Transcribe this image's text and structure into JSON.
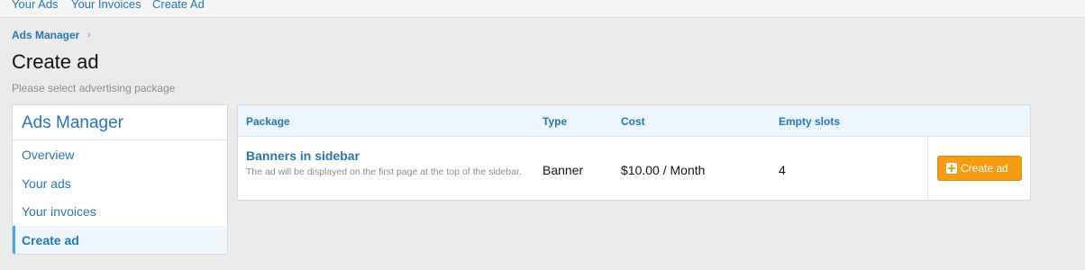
{
  "topnav": {
    "items": [
      {
        "label": "Your Ads"
      },
      {
        "label": "Your Invoices"
      },
      {
        "label": "Create Ad"
      }
    ]
  },
  "breadcrumb": {
    "label": "Ads Manager",
    "separator": "›"
  },
  "page": {
    "title": "Create ad",
    "description": "Please select advertising package"
  },
  "sidebar": {
    "title": "Ads Manager",
    "items": [
      {
        "label": "Overview"
      },
      {
        "label": "Your ads"
      },
      {
        "label": "Your invoices"
      },
      {
        "label": "Create ad",
        "active": true
      }
    ]
  },
  "table": {
    "headers": {
      "package": "Package",
      "type": "Type",
      "cost": "Cost",
      "empty_slots": "Empty slots"
    },
    "rows": [
      {
        "title": "Banners in sidebar",
        "description": "The ad will be displayed on the first page at the top of the sidebar.",
        "type": "Banner",
        "cost": "$10.00 / Month",
        "empty_slots": "4",
        "action_label": "Create ad",
        "action_icon": "plus-square-icon"
      }
    ]
  },
  "colors": {
    "link": "#2577b1",
    "accent_button": "#f39c12",
    "background": "#ebebeb"
  }
}
